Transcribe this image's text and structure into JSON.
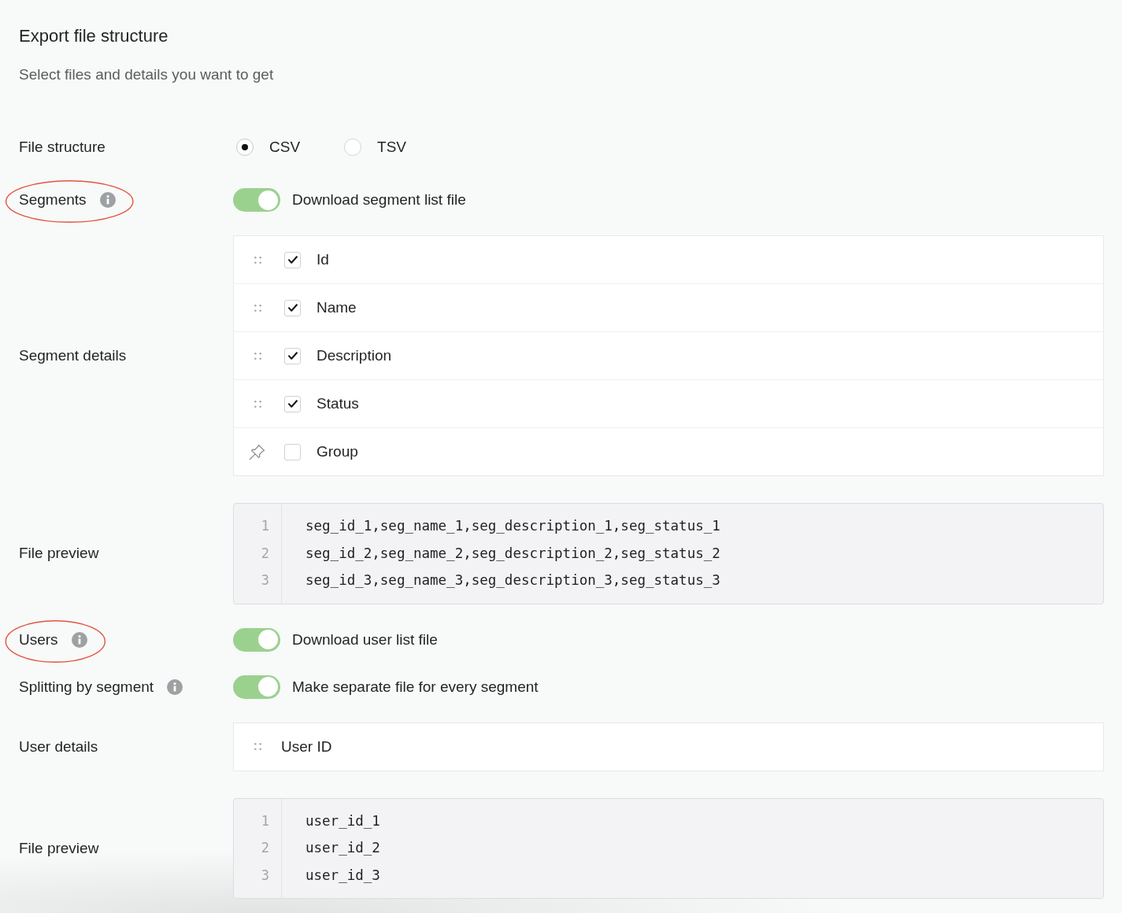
{
  "header": {
    "title": "Export file structure",
    "subtitle": "Select files and details you want to get"
  },
  "rows": [
    {
      "kind": "radio",
      "label": "File structure",
      "info": false,
      "circled": false,
      "options": [
        {
          "label": "CSV",
          "selected": true
        },
        {
          "label": "TSV",
          "selected": false
        }
      ]
    },
    {
      "kind": "toggle",
      "label": "Segments",
      "info": true,
      "circled": true,
      "toggle": {
        "label": "Download segment list file",
        "on": true
      }
    },
    {
      "kind": "checklist",
      "label": "Segment details",
      "info": false,
      "circled": false,
      "items": [
        {
          "label": "Id",
          "checked": true,
          "pinned": false
        },
        {
          "label": "Name",
          "checked": true,
          "pinned": false
        },
        {
          "label": "Description",
          "checked": true,
          "pinned": false
        },
        {
          "label": "Status",
          "checked": true,
          "pinned": false
        },
        {
          "label": "Group",
          "checked": false,
          "pinned": true
        }
      ]
    },
    {
      "kind": "preview",
      "label": "File preview",
      "info": false,
      "circled": false,
      "lines": [
        {
          "number": "1",
          "text": "seg_id_1,seg_name_1,seg_description_1,seg_status_1"
        },
        {
          "number": "2",
          "text": "seg_id_2,seg_name_2,seg_description_2,seg_status_2"
        },
        {
          "number": "3",
          "text": "seg_id_3,seg_name_3,seg_description_3,seg_status_3"
        }
      ]
    },
    {
      "kind": "toggle",
      "label": "Users",
      "info": true,
      "circled": true,
      "toggle": {
        "label": "Download user list file",
        "on": true
      }
    },
    {
      "kind": "toggle",
      "label": "Splitting by segment",
      "info": true,
      "circled": false,
      "toggle": {
        "label": "Make separate file for every segment",
        "on": true
      }
    },
    {
      "kind": "fieldlist",
      "label": "User details",
      "info": false,
      "circled": false,
      "items": [
        {
          "label": "User ID"
        }
      ]
    },
    {
      "kind": "preview",
      "label": "File preview",
      "info": false,
      "circled": false,
      "lines": [
        {
          "number": "1",
          "text": "user_id_1"
        },
        {
          "number": "2",
          "text": "user_id_2"
        },
        {
          "number": "3",
          "text": "user_id_3"
        }
      ]
    }
  ]
}
